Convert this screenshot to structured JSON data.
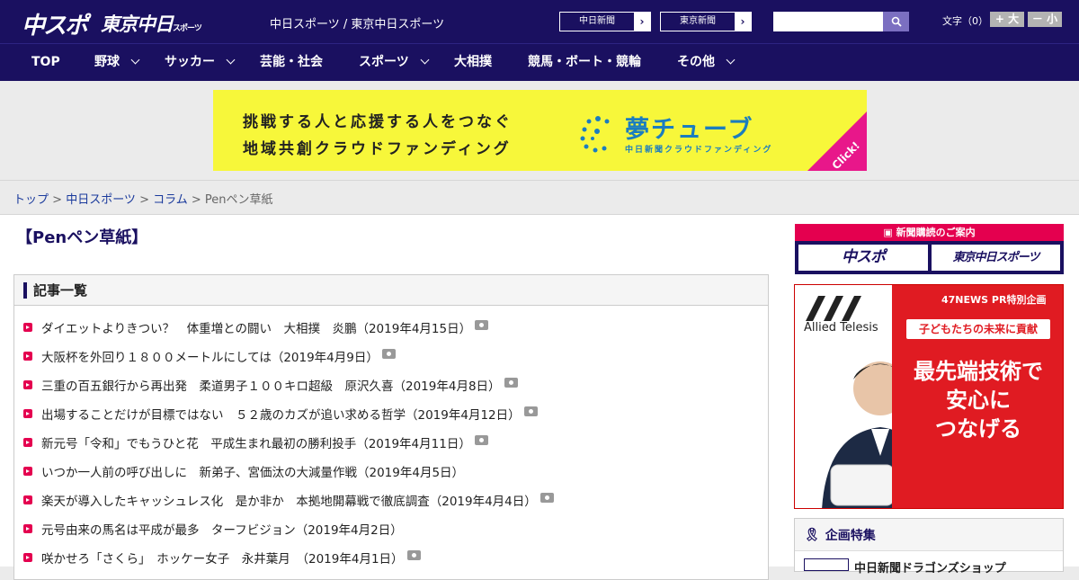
{
  "header": {
    "logo_main": "中スポ",
    "logo_tokyo": "東京中日",
    "logo_tokyo_sub": "スポーツ",
    "site_title": "中日スポーツ / 東京中日スポーツ",
    "ext_links": [
      {
        "label": "中日新聞",
        "arrow": "›"
      },
      {
        "label": "東京新聞",
        "arrow": "›"
      }
    ],
    "search_value": "",
    "font_size_label": "文字（0）",
    "font_plus": "+ 大",
    "font_minus": "－ 小"
  },
  "nav": {
    "items": [
      {
        "label": "TOP",
        "has_menu": false
      },
      {
        "label": "野球",
        "has_menu": true
      },
      {
        "label": "サッカー",
        "has_menu": true
      },
      {
        "label": "芸能・社会",
        "has_menu": false
      },
      {
        "label": "スポーツ",
        "has_menu": true
      },
      {
        "label": "大相撲",
        "has_menu": false
      },
      {
        "label": "競馬・ボート・競輪",
        "has_menu": false
      },
      {
        "label": "その他",
        "has_menu": true
      }
    ]
  },
  "banner": {
    "line1": "挑戦する人と応援する人をつなぐ",
    "line2": "地域共創クラウドファンディング",
    "brand": "夢チューブ",
    "brand_sub": "中日新聞クラウドファンディング",
    "click": "Click!"
  },
  "breadcrumb": {
    "items": [
      "トップ",
      "中日スポーツ",
      "コラム"
    ],
    "current": "Penペン草紙",
    "separator": " > "
  },
  "page": {
    "title": "【Penペン草紙】",
    "list_heading": "記事一覧",
    "articles": [
      {
        "text": "ダイエットよりきつい？　体重増との闘い　大相撲　炎鵬（2019年4月15日）",
        "photo": true
      },
      {
        "text": "大阪杯を外回り１８００メートルにしては（2019年4月9日）",
        "photo": true
      },
      {
        "text": "三重の百五銀行から再出発　柔道男子１００キロ超級　原沢久喜（2019年4月8日）",
        "photo": true
      },
      {
        "text": "出場することだけが目標ではない　５２歳のカズが追い求める哲学（2019年4月12日）",
        "photo": true
      },
      {
        "text": "新元号「令和」でもうひと花　平成生まれ最初の勝利投手（2019年4月11日）",
        "photo": true
      },
      {
        "text": "いつか一人前の呼び出しに　新弟子、宮価汰の大減量作戦（2019年4月5日）",
        "photo": false
      },
      {
        "text": "楽天が導入したキャッシュレス化　是か非か　本拠地開幕戦で徹底調査（2019年4月4日）",
        "photo": true
      },
      {
        "text": "元号由来の馬名は平成が最多　ターフビジョン（2019年4月2日）",
        "photo": false
      },
      {
        "text": "咲かせろ「さくら」　ホッケー女子　永井葉月　（2019年4月1日）",
        "photo": true
      }
    ]
  },
  "sidebar": {
    "subscribe_head": "新聞購読のご案内",
    "subscribe_logos": [
      "中スポ",
      "東京中日スポーツ"
    ],
    "ad": {
      "company": "Allied Telesis",
      "tag": "47NEWS PR特別企画",
      "strip": "子どもたちの未来に貢献",
      "lines": [
        "最先端技術で",
        "安心に",
        "つなげる"
      ]
    },
    "feature_head": "企画特集",
    "feature_item": "中日新聞ドラゴンズショップ"
  }
}
